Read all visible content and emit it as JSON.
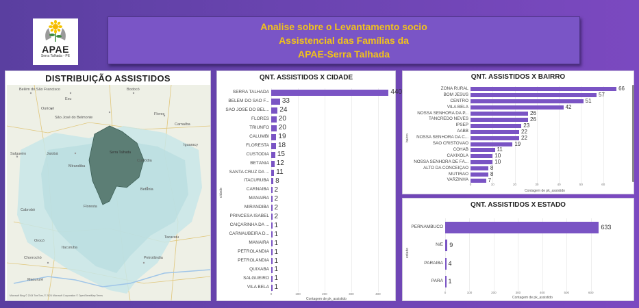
{
  "logo": {
    "name": "APAE",
    "subtitle": "Serra Talhada - PE"
  },
  "title": {
    "line1": "Analise sobre o Levantamento socio",
    "line2": "Assistencial das Famílias da",
    "line3": "APAE-Serra Talhada"
  },
  "map": {
    "title": "DISTRIBUIÇÃO ASSISTIDOS",
    "highlight_label": "Serra Talhada",
    "labels": [
      "Exu",
      "Bodocó",
      "Cabrobó",
      "Ouricuri",
      "Salgueiro",
      "Mirandiba",
      "Flores",
      "Carnaíba",
      "Afogados da Ingazeira",
      "Tuparetama",
      "Iguaracy",
      "Sertânia",
      "Custódia",
      "Betânia",
      "Floresta",
      "Triunfo",
      "Princesa Isabel",
      "Calumbi",
      "Itacuruba",
      "Petrolândia",
      "Belém do São Francisco",
      "Orocó",
      "Chorrochó",
      "Macururé",
      "Paulo Afonso",
      "Jatobá",
      "Tacaratu",
      "Inajá",
      "Araripina",
      "Verdejante",
      "Penaforte",
      "Itaporanga",
      "Conceição",
      "Manaíra",
      "Carnaubeira da Penha",
      "São José do Belmonte"
    ],
    "attribution": "Microsoft Bing  © 2024 TomTom, © 2024 Microsoft Corporation  © OpenStreetMap  Terms"
  },
  "chart_data": [
    {
      "type": "bar",
      "title": "QNT. ASSISTIDOS X CIDADE",
      "xlabel": "Contagem de pk_assistido",
      "ylabel": "cidade",
      "categories": [
        "SERRA TALHADA",
        "BELÉM DO SÃO F...",
        "SÃO JOSÉ DO BEL...",
        "FLORES",
        "TRIUNFO",
        "CALUMBI",
        "FLORESTA",
        "CUSTODIA",
        "BETÂNIA",
        "SANTA CRUZ DA ...",
        "ITACURUBA",
        "CARNAÍBA",
        "MANAÍRA",
        "MIRANDIBA",
        "PRINCESA ISABEL",
        "CAIÇARINHA DA ...",
        "CARNAUBEIRA D...",
        "MANAIRA",
        "PETROLANDIA",
        "PETROLÂNDIA",
        "QUIXABÁ",
        "SALGUEIRO",
        "VILA BELA"
      ],
      "values": [
        440,
        33,
        24,
        20,
        20,
        19,
        18,
        15,
        12,
        11,
        8,
        2,
        2,
        2,
        2,
        1,
        1,
        1,
        1,
        1,
        1,
        1,
        1
      ],
      "xlim": [
        0,
        480
      ],
      "xticks": [
        "0",
        "100",
        "200",
        "300",
        "400"
      ],
      "grid": true
    },
    {
      "type": "bar",
      "title": "QNT. ASSISTIDOS X BAIRRO",
      "xlabel": "Contagem de pk_assistido",
      "ylabel": "bairro",
      "categories": [
        "ZONA RURAL",
        "BOM JESUS",
        "CENTRO",
        "VILA BELA",
        "NOSSA SENHORA DA P...",
        "TANCREDO NEVES",
        "IPSEP",
        "AABB",
        "NOSSA SENHORA DA C...",
        "SÃO CRISTÓVÃO",
        "COHAB",
        "CAXIXOLA",
        "NOSSA SENHORA DE FÁ...",
        "ALTO DA CONCEIÇÃO",
        "MUTIRÃO",
        "VARZINHA"
      ],
      "values": [
        66,
        57,
        51,
        42,
        26,
        26,
        23,
        22,
        22,
        19,
        11,
        10,
        10,
        8,
        8,
        7
      ],
      "xlim": [
        0,
        70
      ],
      "xticks": [
        "0",
        "10",
        "20",
        "30",
        "40",
        "50",
        "60"
      ],
      "grid": true
    },
    {
      "type": "bar",
      "title": "QNT. ASSISTIDOS X ESTADO",
      "xlabel": "Contagem de pk_assistido",
      "ylabel": "estado",
      "categories": [
        "PERNAMBUCO",
        "N/E",
        "PARAÍBA",
        "PARÁ"
      ],
      "values": [
        633,
        9,
        4,
        1
      ],
      "xlim": [
        0,
        660
      ],
      "xticks": [
        "0",
        "100",
        "200",
        "300",
        "400",
        "500",
        "600"
      ],
      "grid": true
    }
  ],
  "colors": {
    "bar": "#7a54c4",
    "title_text": "#f2c21a",
    "background_start": "#5a3fa0",
    "background_end": "#7b49c0"
  }
}
